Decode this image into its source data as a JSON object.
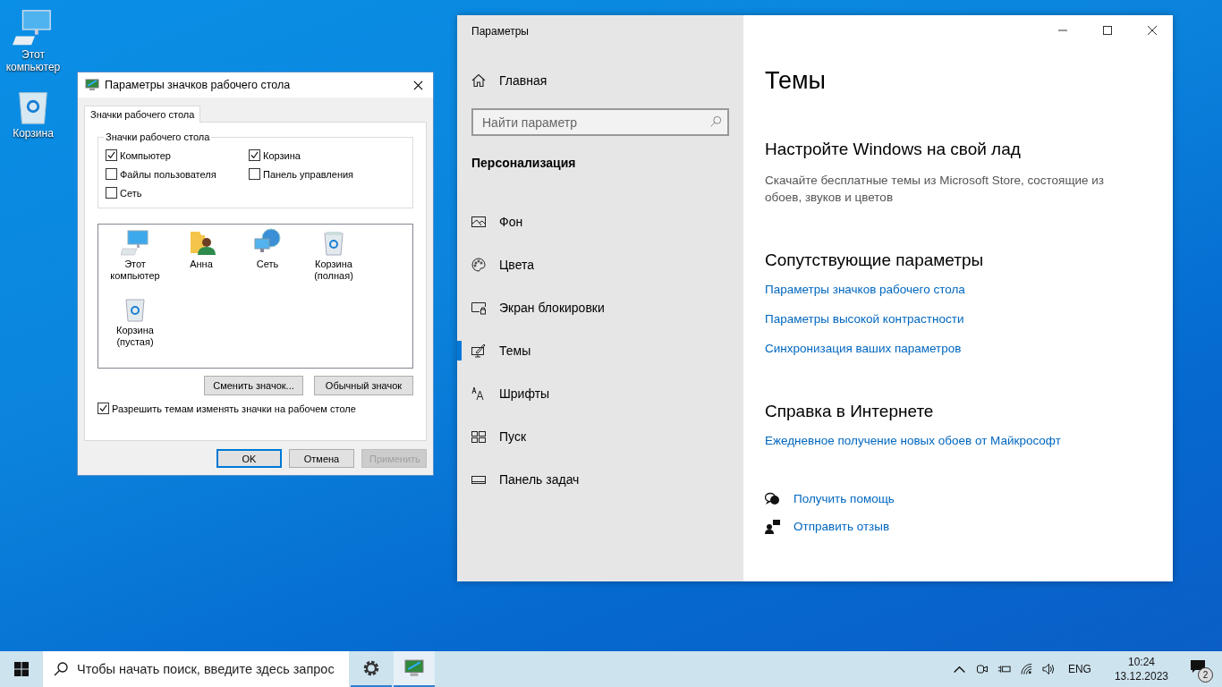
{
  "desktop_icons": [
    {
      "label": "Этот компьютер",
      "kind": "computer"
    },
    {
      "label": "Корзина",
      "kind": "bin"
    }
  ],
  "dialog": {
    "title": "Параметры значков рабочего стола",
    "tabs": [
      {
        "label": "Значки рабочего стола",
        "selected": true
      }
    ],
    "group_title": "Значки рабочего стола",
    "checkboxes": [
      {
        "label": "Компьютер",
        "checked": true
      },
      {
        "label": "Корзина",
        "checked": true
      },
      {
        "label": "Файлы пользователя",
        "checked": false
      },
      {
        "label": "Панель управления",
        "checked": false
      },
      {
        "label": "Сеть",
        "checked": false
      }
    ],
    "icons": [
      {
        "label": "Этот компьютер",
        "kind": "computer"
      },
      {
        "label": "Анна",
        "kind": "user"
      },
      {
        "label": "Сеть",
        "kind": "network"
      },
      {
        "label": "Корзина (полная)",
        "kind": "bin-full"
      },
      {
        "label": "Корзина (пустая)",
        "kind": "bin"
      }
    ],
    "icon_buttons": [
      {
        "label": "Сменить значок...",
        "disabled": false
      },
      {
        "label": "Обычный значок",
        "disabled": false
      }
    ],
    "allow_themes": {
      "label": "Разрешить темам изменять значки на рабочем столе",
      "checked": true
    },
    "footer_buttons": [
      {
        "label": "OK",
        "default": true,
        "disabled": false
      },
      {
        "label": "Отмена",
        "default": false,
        "disabled": false
      },
      {
        "label": "Применить",
        "default": false,
        "disabled": true
      }
    ]
  },
  "settings": {
    "title": "Параметры",
    "home": "Главная",
    "search": {
      "placeholder": "Найти параметр"
    },
    "section": "Персонализация",
    "nav": [
      {
        "label": "Фон",
        "kind": "picture",
        "selected": false
      },
      {
        "label": "Цвета",
        "kind": "palette",
        "selected": false
      },
      {
        "label": "Экран блокировки",
        "kind": "lock",
        "selected": false
      },
      {
        "label": "Темы",
        "kind": "themes",
        "selected": true
      },
      {
        "label": "Шрифты",
        "kind": "fonts",
        "selected": false
      },
      {
        "label": "Пуск",
        "kind": "start",
        "selected": false
      },
      {
        "label": "Панель задач",
        "kind": "taskbar",
        "selected": false
      }
    ],
    "page_title": "Темы",
    "blocks": [
      {
        "heading": "Настройте Windows на свой лад",
        "text": "Скачайте бесплатные темы из Microsoft Store, состоящие из обоев, звуков и цветов"
      },
      {
        "heading": "Сопутствующие параметры",
        "links": [
          "Параметры значков рабочего стола",
          "Параметры высокой контрастности",
          "Синхронизация ваших параметров"
        ]
      },
      {
        "heading": "Справка в Интернете",
        "links": [
          "Ежедневное получение новых обоев от Майкрософт"
        ]
      }
    ],
    "help": [
      {
        "label": "Получить помощь",
        "kind": "help"
      },
      {
        "label": "Отправить отзыв",
        "kind": "feedback"
      }
    ]
  },
  "taskbar": {
    "search": {
      "placeholder": "Чтобы начать поиск, введите здесь запрос"
    },
    "apps": [
      {
        "kind": "gear",
        "selected": false
      },
      {
        "kind": "display",
        "selected": true
      }
    ],
    "language": "ENG",
    "time": "10:24",
    "date": "13.12.2023",
    "notifications": "2"
  }
}
